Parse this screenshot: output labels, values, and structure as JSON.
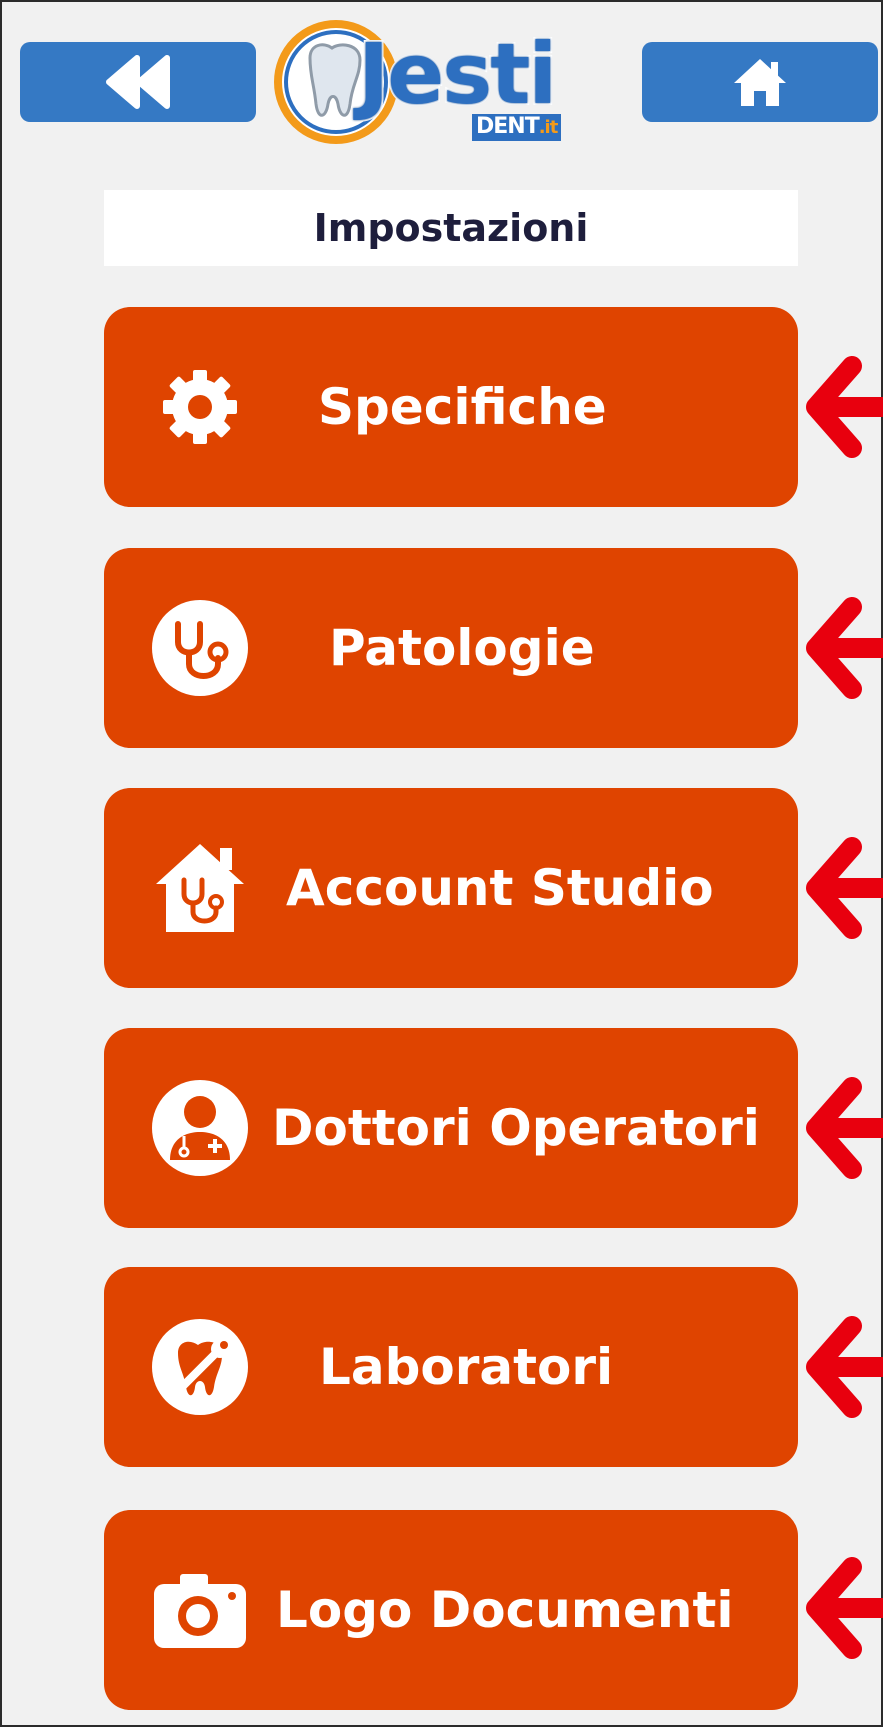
{
  "header": {
    "back_icon": "rewind-icon",
    "home_icon": "home-icon",
    "logo_text": "Jesti",
    "logo_sub": "DENT",
    "logo_sub_suffix": ".it"
  },
  "page_title": "Impostazioni",
  "menu": [
    {
      "label": "Specifiche",
      "icon": "gear-icon"
    },
    {
      "label": "Patologie",
      "icon": "stethoscope-icon"
    },
    {
      "label": "Account Studio",
      "icon": "house-stethoscope-icon"
    },
    {
      "label": "Dottori Operatori",
      "icon": "doctor-icon"
    },
    {
      "label": "Laboratori",
      "icon": "tooth-wrench-icon"
    },
    {
      "label": "Logo Documenti",
      "icon": "camera-icon"
    }
  ],
  "colors": {
    "background": "#f1f1f1",
    "nav_blue": "#3579c4",
    "menu_orange": "#df4400",
    "arrow_red": "#e8000e",
    "title_text": "#1e1e3c"
  }
}
